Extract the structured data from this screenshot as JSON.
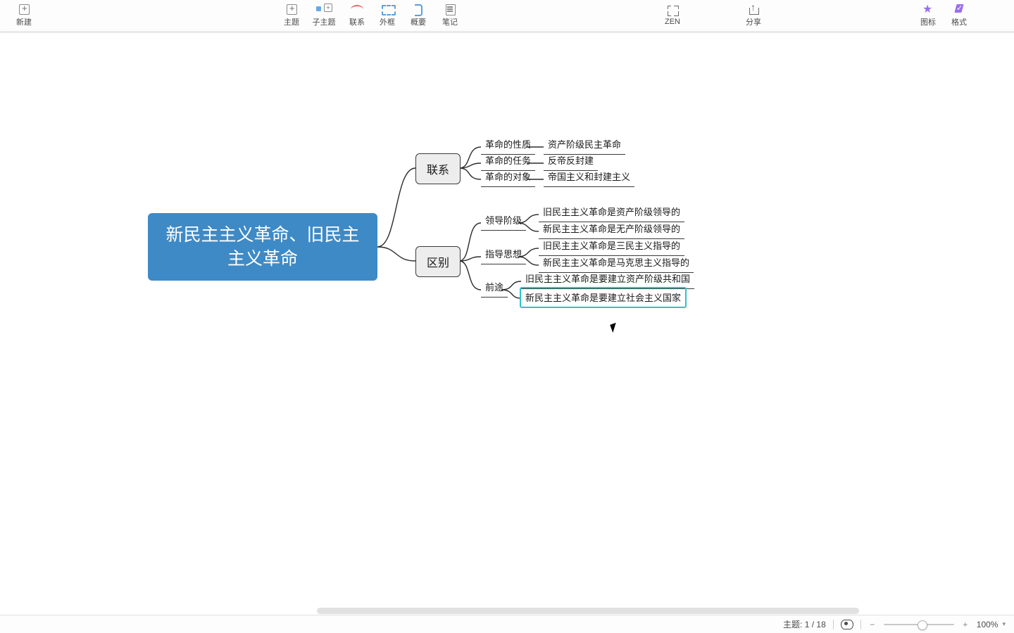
{
  "toolbar": {
    "left": [
      {
        "name": "new",
        "label": "新建"
      }
    ],
    "mid": [
      {
        "name": "topic",
        "label": "主题"
      },
      {
        "name": "subtopic",
        "label": "子主题"
      },
      {
        "name": "relationship",
        "label": "联系"
      },
      {
        "name": "boundary",
        "label": "外框"
      },
      {
        "name": "summary",
        "label": "概要"
      },
      {
        "name": "notes",
        "label": "笔记"
      }
    ],
    "zen": {
      "label": "ZEN"
    },
    "share": {
      "label": "分享"
    },
    "right": [
      {
        "name": "icons",
        "label": "图标"
      },
      {
        "name": "format",
        "label": "格式"
      }
    ]
  },
  "map": {
    "root": "新民主主义革命、旧民主主义革命",
    "branch1": {
      "title": "联系",
      "rows": [
        {
          "k": "革命的性质",
          "v": "资产阶级民主革命"
        },
        {
          "k": "革命的任务",
          "v": "反帝反封建"
        },
        {
          "k": "革命的对象",
          "v": "帝国主义和封建主义"
        }
      ]
    },
    "branch2": {
      "title": "区别",
      "groups": [
        {
          "k": "领导阶级",
          "v": [
            "旧民主主义革命是资产阶级领导的",
            "新民主主义革命是无产阶级领导的"
          ]
        },
        {
          "k": "指导思想",
          "v": [
            "旧民主主义革命是三民主义指导的",
            "新民主主义革命是马克思主义指导的"
          ]
        },
        {
          "k": "前途",
          "v": [
            "旧民主主义革命是要建立资产阶级共和国",
            "新民主主义革命是要建立社会主义国家"
          ]
        }
      ]
    }
  },
  "status": {
    "topic_label": "主题:",
    "topic_current": "1",
    "topic_sep": "/",
    "topic_total": "18",
    "zoom_percent": "100%"
  }
}
